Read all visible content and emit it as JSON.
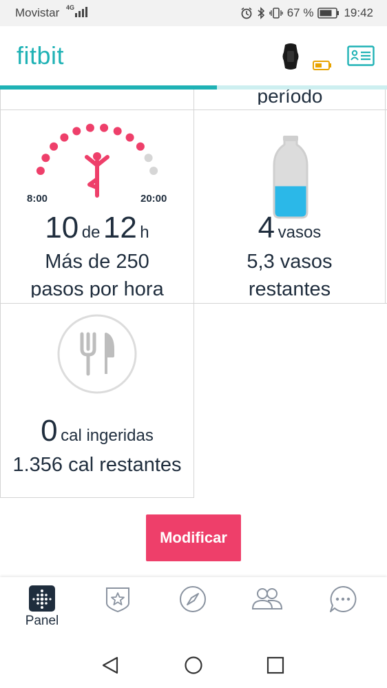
{
  "status_bar": {
    "carrier": "Movistar",
    "network": "4G",
    "battery": "67 %",
    "time": "19:42",
    "icons": [
      "alarm-icon",
      "bluetooth-icon",
      "vibrate-icon",
      "battery-icon"
    ]
  },
  "header": {
    "logo": "fitbit",
    "icons": [
      "tracker-device-icon",
      "tracker-battery-icon",
      "profile-card-icon"
    ],
    "sync_progress": 0.56
  },
  "tiles": {
    "top_cut_text": "período",
    "hourly": {
      "icon": "active-figure-icon",
      "start_label": "8:00",
      "end_label": "20:00",
      "value": "10",
      "connector": "de",
      "goal": "12",
      "unit": "h",
      "sub": "Más de 250",
      "sub2": "pasos por hora",
      "hours_active": 10,
      "hours_total": 12,
      "active_color": "#ee3f6a",
      "inactive_color": "#d6d6d6"
    },
    "water": {
      "icon": "water-bottle-icon",
      "value": "4",
      "unit": "vasos",
      "sub": "5,3 vasos",
      "sub2": "restantes",
      "fill_fraction": 0.43,
      "fill_color": "#2bb8e8"
    },
    "food": {
      "icon": "fork-knife-icon",
      "value": "0",
      "unit": "cal ingeridas",
      "sub": "1.356 cal restantes"
    }
  },
  "modify_button": {
    "label": "Modificar",
    "color": "#ee3f6a"
  },
  "tabbar": {
    "tabs": [
      {
        "label": "Panel",
        "icon": "dashboard-icon",
        "active": true
      },
      {
        "label": "",
        "icon": "challenges-star-icon"
      },
      {
        "label": "",
        "icon": "compass-icon"
      },
      {
        "label": "",
        "icon": "friends-icon"
      },
      {
        "label": "",
        "icon": "chat-icon"
      }
    ]
  },
  "android_nav": {
    "icons": [
      "back-icon",
      "home-icon",
      "recents-icon"
    ]
  }
}
